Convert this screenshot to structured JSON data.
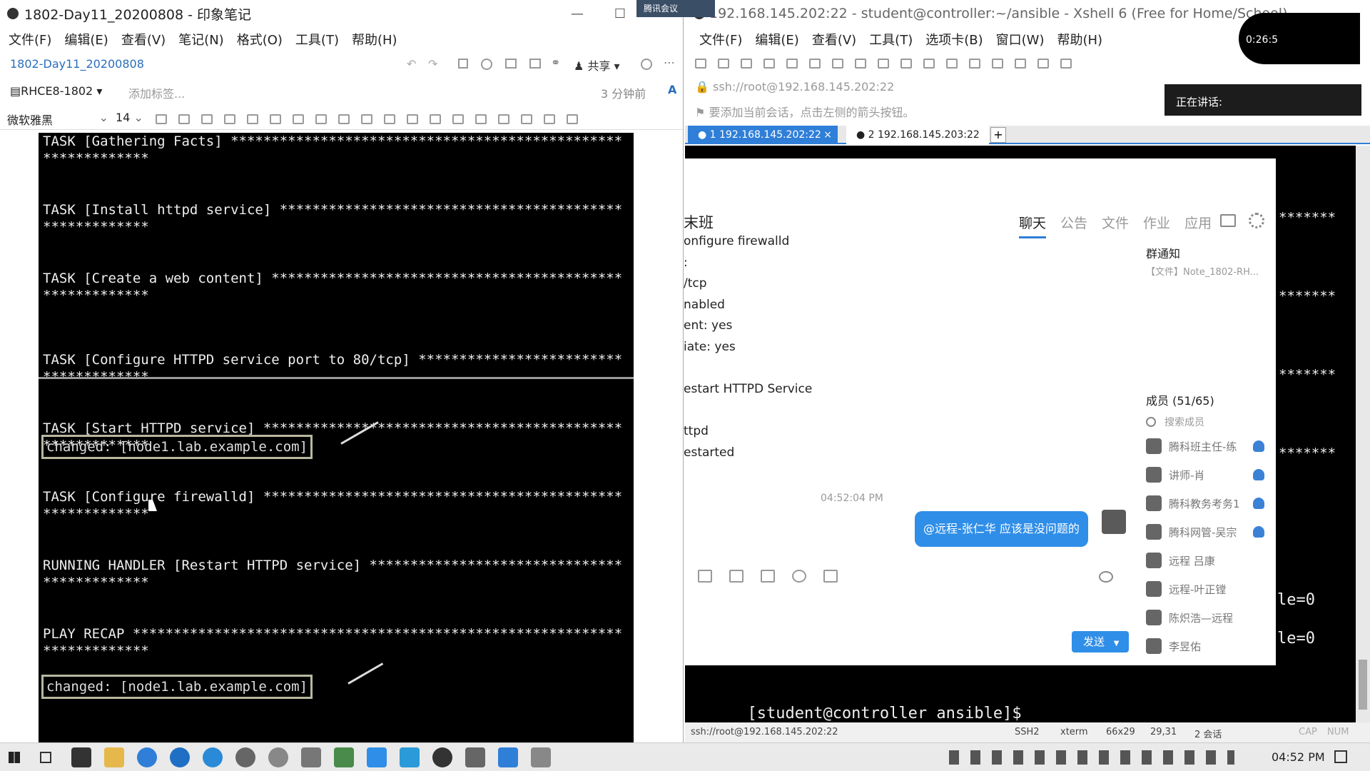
{
  "evernote": {
    "title": "1802-Day11_20200808 - 印象笔记",
    "menu": [
      "文件(F)",
      "编辑(E)",
      "查看(V)",
      "笔记(N)",
      "格式(O)",
      "工具(T)",
      "帮助(H)"
    ],
    "note_title": "1802-Day11_20200808",
    "share_label": "共享",
    "notebook": "RHCE8-1802",
    "add_tag": "添加标签...",
    "modified": "3 分钟前",
    "font_family": "微软雅黑",
    "font_size": "14",
    "terminal_lines": [
      "TASK [Gathering Facts] ************************************************",
      "*************",
      "",
      "",
      "TASK [Install httpd service] ******************************************",
      "*************",
      "",
      "",
      "TASK [Create a web content] *******************************************",
      "*************",
      "",
      "",
      "TASK [Configure HTTPD service port to 80/tcp] *************************",
      "*************",
      "",
      "",
      "TASK [Start HTTPD service] ********************************************",
      "*************",
      "",
      "",
      "TASK [Configure firewalld] ********************************************",
      "*************",
      "",
      "",
      "RUNNING HANDLER [Restart HTTPD service] *******************************",
      "*************",
      "",
      "",
      "PLAY RECAP ************************************************************",
      "*************"
    ],
    "changed_1": "changed: [node1.lab.example.com]",
    "changed_2": "changed: [node1.lab.example.com]"
  },
  "xshell": {
    "title": "192.168.145.202:22 - student@controller:~/ansible - Xshell 6 (Free for Home/School)",
    "menu": [
      "文件(F)",
      "编辑(E)",
      "查看(V)",
      "工具(T)",
      "选项卡(B)",
      "窗口(W)",
      "帮助(H)"
    ],
    "address": "ssh://root@192.168.145.202:22",
    "hint": "要添加当前会话，点击左侧的箭头按钮。",
    "tabs": [
      "1 192.168.145.202:22",
      "2 192.168.145.203:22"
    ],
    "right_stars": [
      "*******",
      "*******",
      "*******",
      "*******",
      "*******"
    ],
    "right_le": [
      "le=0",
      "le=0"
    ],
    "prompt": "[student@controller ansible]$",
    "status": {
      "address": "ssh://root@192.168.145.202:22",
      "protocol": "SSH2",
      "term": "xterm",
      "size": "66x29",
      "pos": "29,31",
      "sessions": "2 会话",
      "cap": "CAP",
      "num": "NUM"
    }
  },
  "meeting": {
    "top_label": "腾讯会议",
    "timer": "0:26:5",
    "speaking": "正在讲话:"
  },
  "chat": {
    "group_name": "末班",
    "tabs": [
      "聊天",
      "公告",
      "文件",
      "作业",
      "应用"
    ],
    "messages": [
      "onfigure firewalld",
      ":",
      "/tcp",
      "nabled",
      "ent: yes",
      "iate: yes",
      "",
      "estart HTTPD Service",
      "",
      "ttpd",
      "estarted"
    ],
    "time": "04:52:04 PM",
    "bubble": "@远程-张仁华 应该是没问题的",
    "notice_title": "群通知",
    "notice_file": "【文件】Note_1802-RH...",
    "members_title": "成员 (51/65)",
    "search_members": "搜索成员",
    "members": [
      "腾科班主任-练",
      "讲师-肖",
      "腾科教务考务1",
      "腾科网管-吴宗",
      "远程 吕康",
      "远程-叶正镗",
      "陈炽浩—远程",
      "李昱佑"
    ],
    "send": "发送"
  },
  "taskbar": {
    "time": "04:52 PM"
  }
}
